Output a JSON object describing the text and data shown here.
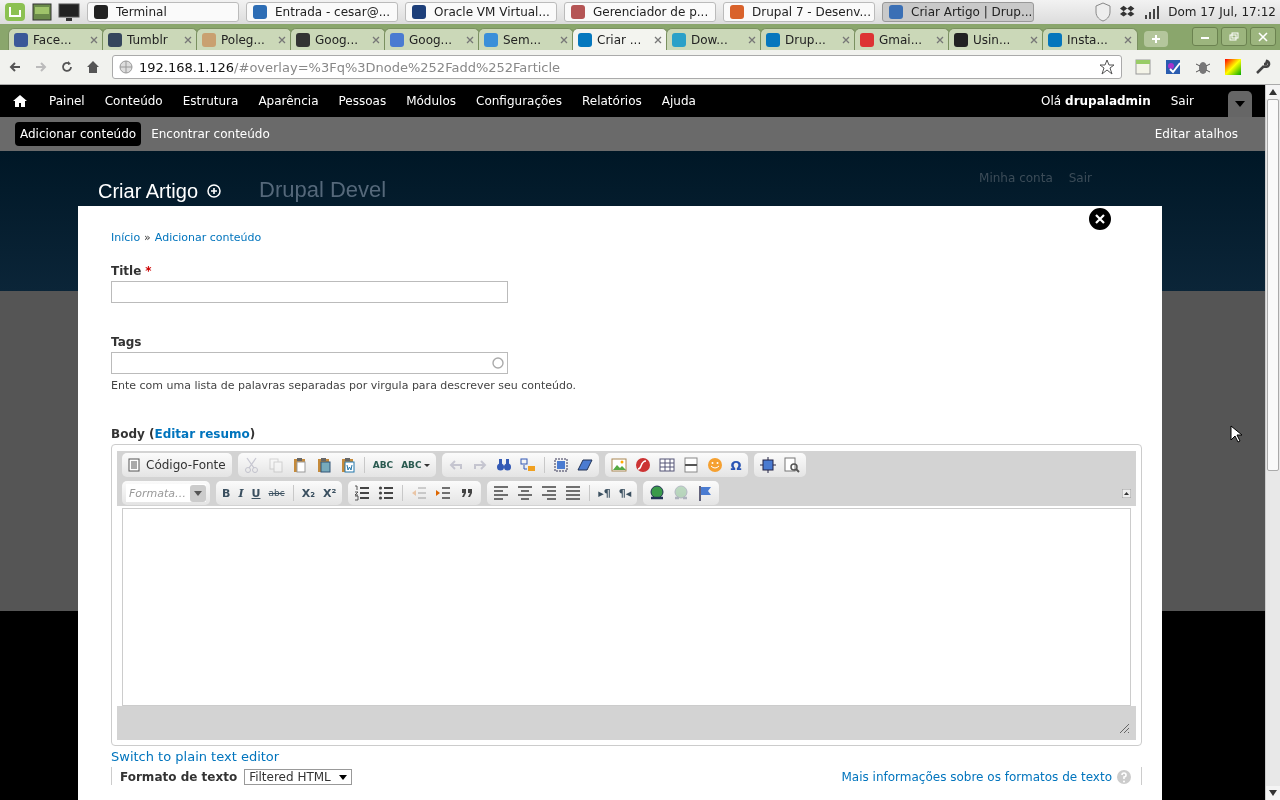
{
  "panel": {
    "tasks": [
      {
        "label": "Terminal",
        "selected": false,
        "color": "#222222"
      },
      {
        "label": "Entrada - cesar@...",
        "selected": false,
        "color": "#2d6db5"
      },
      {
        "label": "Oracle VM Virtual...",
        "selected": false,
        "color": "#1d3f7a"
      },
      {
        "label": "Gerenciador de p...",
        "selected": false,
        "color": "#b55555"
      },
      {
        "label": "Drupal 7 - Desenv...",
        "selected": false,
        "color": "#d9622b"
      },
      {
        "label": "Criar Artigo | Drup...",
        "selected": true,
        "color": "#3a6fb5"
      }
    ],
    "clock": "Dom 17 Jul, 17:12"
  },
  "browser": {
    "tabs": [
      {
        "label": "Face...",
        "selected": false,
        "color": "#3b5998"
      },
      {
        "label": "Tumblr",
        "selected": false,
        "color": "#35465c"
      },
      {
        "label": "Poleg...",
        "selected": false,
        "color": "#c9a070"
      },
      {
        "label": "Goog...",
        "selected": false,
        "color": "#333333"
      },
      {
        "label": "Goog...",
        "selected": false,
        "color": "#4a7bd1"
      },
      {
        "label": "Sem...",
        "selected": false,
        "color": "#3a8fd9"
      },
      {
        "label": "Criar ...",
        "selected": true,
        "color": "#0678be"
      },
      {
        "label": "Dow...",
        "selected": false,
        "color": "#2aa0c8"
      },
      {
        "label": "Drup...",
        "selected": false,
        "color": "#0677bd"
      },
      {
        "label": "Gmai...",
        "selected": false,
        "color": "#dd3333"
      },
      {
        "label": "Usin...",
        "selected": false,
        "color": "#222222"
      },
      {
        "label": "Insta...",
        "selected": false,
        "color": "#0576bc"
      }
    ],
    "url_host": "192.168.1.126",
    "url_path": "/#overlay=%3Fq%3Dnode%252Fadd%252Farticle"
  },
  "toolbar": {
    "menu": [
      "Painel",
      "Conteúdo",
      "Estrutura",
      "Aparência",
      "Pessoas",
      "Módulos",
      "Configurações",
      "Relatórios",
      "Ajuda"
    ],
    "greeting": "Olá **drupaladmin**",
    "logout": "Sair"
  },
  "shortcuts": {
    "items": [
      {
        "label": "Adicionar conteúdo",
        "selected": true
      },
      {
        "label": "Encontrar conteúdo",
        "selected": false
      }
    ],
    "edit": "Editar atalhos"
  },
  "header": {
    "title": "Criar Artigo",
    "site_name": "Drupal Devel",
    "links": [
      "Minha conta",
      "Sair"
    ]
  },
  "overlay": {
    "breadcrumb": [
      "Início",
      "Adicionar conteúdo"
    ],
    "breadcrumb_separator": "»",
    "title_field": {
      "label": "Title",
      "required": true,
      "required_mark": "*"
    },
    "tags_field": {
      "label": "Tags",
      "description": "Ente com uma lista de palavras separadas por virgula para descrever seu conteúdo."
    },
    "body": {
      "label_before": "Body (",
      "link": "Editar resumo",
      "label_after": ")"
    },
    "editor_rows": [
      [
        [
          {
            "kind": "source",
            "label": "Código-Fonte",
            "disabled": false
          }
        ],
        [
          {
            "kind": "cut",
            "disabled": true
          },
          {
            "kind": "copy",
            "disabled": true
          },
          {
            "kind": "paste",
            "disabled": false
          },
          {
            "kind": "paste_text",
            "disabled": false
          },
          {
            "kind": "paste_word",
            "disabled": false
          },
          {
            "kind": "separator"
          },
          {
            "kind": "spell",
            "label": "ABC",
            "disabled": false
          },
          {
            "kind": "spell_menu",
            "label": "ABC",
            "disabled": false
          }
        ],
        [
          {
            "kind": "undo",
            "disabled": true
          },
          {
            "kind": "redo",
            "disabled": true
          },
          {
            "kind": "find",
            "disabled": false
          },
          {
            "kind": "replace",
            "disabled": false
          },
          {
            "kind": "separator"
          },
          {
            "kind": "select_all",
            "disabled": false
          },
          {
            "kind": "remove_format",
            "disabled": false
          }
        ],
        [
          {
            "kind": "image",
            "disabled": false
          },
          {
            "kind": "flash",
            "disabled": false
          },
          {
            "kind": "table",
            "disabled": false
          },
          {
            "kind": "hr",
            "disabled": false
          },
          {
            "kind": "smiley",
            "disabled": false
          },
          {
            "kind": "special_char",
            "label": "Ω",
            "disabled": false
          }
        ],
        [
          {
            "kind": "maximize",
            "disabled": false
          },
          {
            "kind": "show_blocks",
            "disabled": false
          }
        ]
      ],
      [
        [
          {
            "kind": "format",
            "label": "Formata…",
            "disabled": false
          }
        ],
        [
          {
            "kind": "bold",
            "label": "B",
            "disabled": false
          },
          {
            "kind": "italic",
            "label": "I",
            "disabled": false
          },
          {
            "kind": "underline",
            "label": "U",
            "disabled": false
          },
          {
            "kind": "strike",
            "label": "abc",
            "disabled": false
          },
          {
            "kind": "separator"
          },
          {
            "kind": "subscript",
            "label": "X₂",
            "disabled": false
          },
          {
            "kind": "superscript",
            "label": "X²",
            "disabled": false
          }
        ],
        [
          {
            "kind": "ol",
            "disabled": false
          },
          {
            "kind": "ul",
            "disabled": false
          },
          {
            "kind": "separator"
          },
          {
            "kind": "outdent",
            "disabled": true
          },
          {
            "kind": "indent",
            "disabled": false
          },
          {
            "kind": "blockquote",
            "disabled": false
          }
        ],
        [
          {
            "kind": "align_left",
            "disabled": false
          },
          {
            "kind": "align_center",
            "disabled": false
          },
          {
            "kind": "align_right",
            "disabled": false
          },
          {
            "kind": "justify",
            "disabled": false
          },
          {
            "kind": "separator"
          },
          {
            "kind": "ltr",
            "label": "▸¶",
            "disabled": false
          },
          {
            "kind": "rtl",
            "label": "¶◂",
            "disabled": false
          }
        ],
        [
          {
            "kind": "link",
            "disabled": false
          },
          {
            "kind": "unlink",
            "disabled": true
          },
          {
            "kind": "anchor",
            "disabled": false
          }
        ]
      ]
    ],
    "switch_link": "Switch to plain text editor",
    "format": {
      "label": "Formato de texto",
      "value": "Filtered HTML",
      "help_link": "Mais informações sobre os formatos de texto"
    }
  }
}
